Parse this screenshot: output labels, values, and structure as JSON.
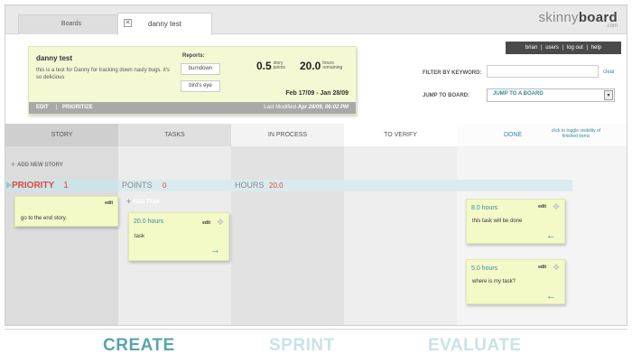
{
  "tabs": {
    "boards": "Boards",
    "board": "danny test",
    "close": "✕"
  },
  "logo": {
    "light": "skinny",
    "bold": "board",
    "sub": ".com"
  },
  "user_nav": {
    "user": "brian",
    "users": "users",
    "logout": "log out",
    "help": "help",
    "sep": "|"
  },
  "board": {
    "name": "danny test",
    "description": "this is a test for Danny for tracking down nasty bugs. it's so delicious",
    "reports_label": "Reports:",
    "reports": [
      "burndown",
      "bird's eye"
    ],
    "points_value": "0.5",
    "points_label_1": "story",
    "points_label_2": "points",
    "hours_value": "20.0",
    "hours_label_1": "hours",
    "hours_label_2": "remaining",
    "date_range": "Feb 17/09 - Jan 28/09",
    "edit": "EDIT",
    "sep": "|",
    "prioritize": "PRIORITIZE",
    "last_modified_label": "Last Modified",
    "last_modified_value": "Apr 28/09, 06:02 PM"
  },
  "filter": {
    "label": "FILTER BY KEYWORD:",
    "value": "",
    "clear": "clear"
  },
  "jump": {
    "label": "JUMP TO BOARD:",
    "value": "JUMP TO A BOARD",
    "arrow": "▾"
  },
  "columns": {
    "story": "STORY",
    "tasks": "TASKS",
    "in_process": "IN PROCESS",
    "to_verify": "TO VERIFY",
    "done": "DONE",
    "toggle_hint": "click to toggle visibility of finished items"
  },
  "add_story": "ADD NEW STORY",
  "add_task": "ADD TASK",
  "plus": "✛",
  "priority_bar": {
    "priority_label": "PRIORITY",
    "priority_value": "1",
    "points_label": "POINTS",
    "points_value": "0",
    "hours_label": "HOURS",
    "hours_value": "20.0"
  },
  "story_card": {
    "edit": "edit",
    "text": "go to the end story."
  },
  "task_cards": [
    {
      "hours": "20.0 hours",
      "edit": "edit",
      "text": "task",
      "arrow": "→"
    },
    {
      "hours": "8.0 hours",
      "edit": "edit",
      "text": "this task will be done",
      "arrow": "←"
    },
    {
      "hours": "5.0 hours",
      "edit": "edit",
      "text": "where is my task?",
      "arrow": "←"
    }
  ],
  "move_icon": "✥",
  "tagline": {
    "create": "CREATE",
    "sprint": "SPRINT",
    "evaluate": "EVALUATE"
  },
  "colors": {
    "accent_teal": "#3a8a9a",
    "priority_red": "#e8433a",
    "card_yellow": "#f4f9c8",
    "tag_active": "#5aa4a9",
    "tag_inactive": "#c9e3e6"
  }
}
